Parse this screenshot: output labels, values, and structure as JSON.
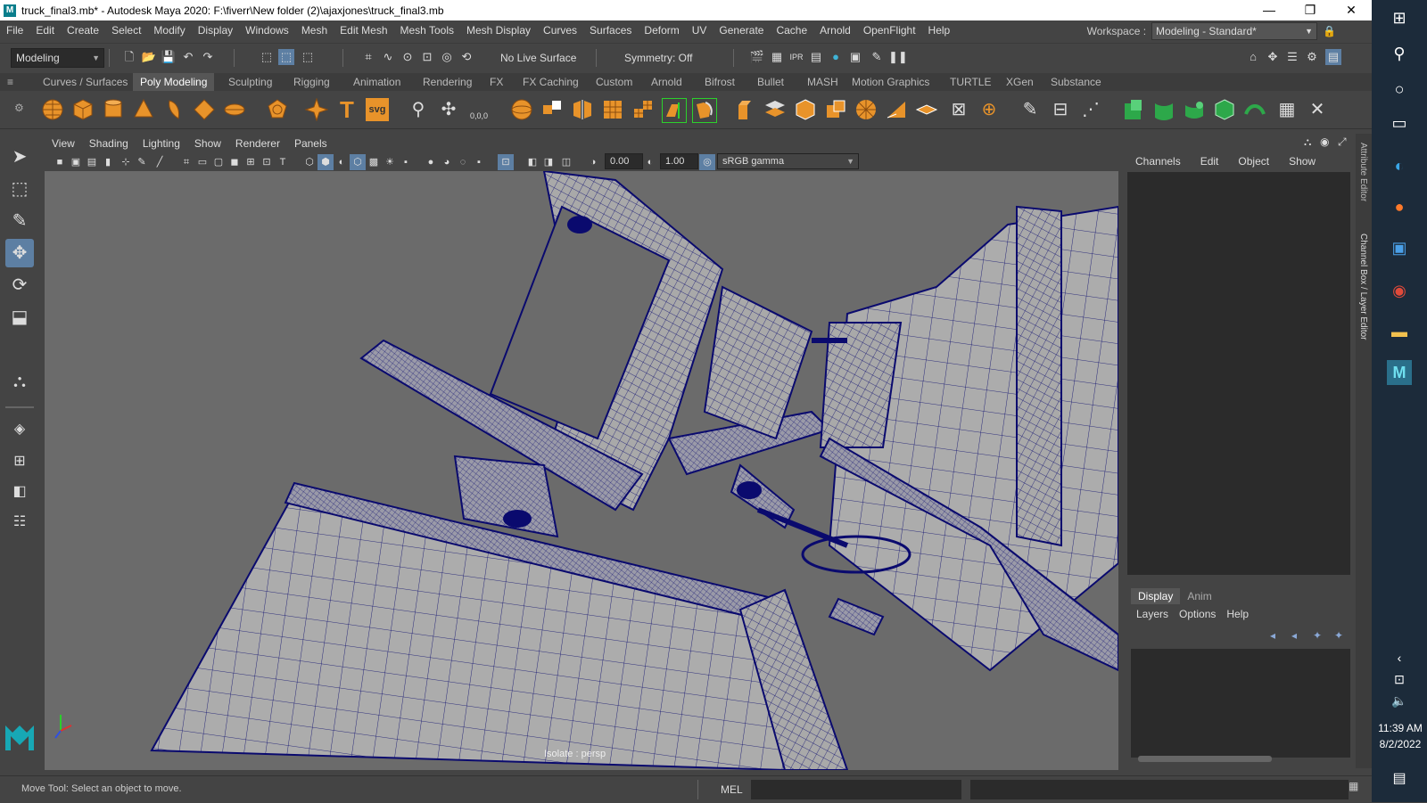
{
  "window": {
    "title": "truck_final3.mb* - Autodesk Maya 2020: F:\\fiverr\\New folder (2)\\ajaxjones\\truck_final3.mb",
    "logo_letter": "M",
    "minimize": "—",
    "restore": "❐",
    "close": "✕"
  },
  "menu": [
    "File",
    "Edit",
    "Create",
    "Select",
    "Modify",
    "Display",
    "Windows",
    "Mesh",
    "Edit Mesh",
    "Mesh Tools",
    "Mesh Display",
    "Curves",
    "Surfaces",
    "Deform",
    "UV",
    "Generate",
    "Cache",
    "Arnold",
    "OpenFlight",
    "Help"
  ],
  "workspace": {
    "label": "Workspace :",
    "value": "Modeling - Standard*"
  },
  "statusline": {
    "mode": "Modeling",
    "live_surface": "No Live Surface",
    "symmetry": "Symmetry: Off"
  },
  "shelf": {
    "tabs": [
      "Curves / Surfaces",
      "Poly Modeling",
      "Sculpting",
      "Rigging",
      "Animation",
      "Rendering",
      "FX",
      "FX Caching",
      "Custom",
      "Arnold",
      "Bifrost",
      "Bullet",
      "MASH",
      "Motion Graphics",
      "TURTLE",
      "XGen",
      "Substance"
    ],
    "active_tab": "Poly Modeling",
    "text_icon": "T",
    "svg_icon": "svg",
    "coord_icon": "0,0,0"
  },
  "viewport": {
    "menus": [
      "View",
      "Shading",
      "Lighting",
      "Show",
      "Renderer",
      "Panels"
    ],
    "exposure": "0.00",
    "gamma": "1.00",
    "color_space": "sRGB gamma",
    "camera_label": "Isolate : persp"
  },
  "channelbox": {
    "menus": [
      "Channels",
      "Edit",
      "Object",
      "Show"
    ],
    "layer_tabs": [
      "Display",
      "Anim"
    ],
    "layer_menus": [
      "Layers",
      "Options",
      "Help"
    ],
    "side_tab_1": "Attribute Editor",
    "side_tab_2": "Channel Box / Layer Editor"
  },
  "helpline": {
    "message": "Move Tool: Select an object to move.",
    "mel_label": "MEL"
  },
  "taskbar": {
    "time": "11:39 AM",
    "date": "8/2/2022"
  },
  "colors": {
    "wire": "#0a0a6e",
    "mesh_fill": "#a8a8a8",
    "viewport_bg": "#6b6b6b",
    "accent_teal": "#0a7e8c",
    "shelf_orange": "#e8932a"
  }
}
